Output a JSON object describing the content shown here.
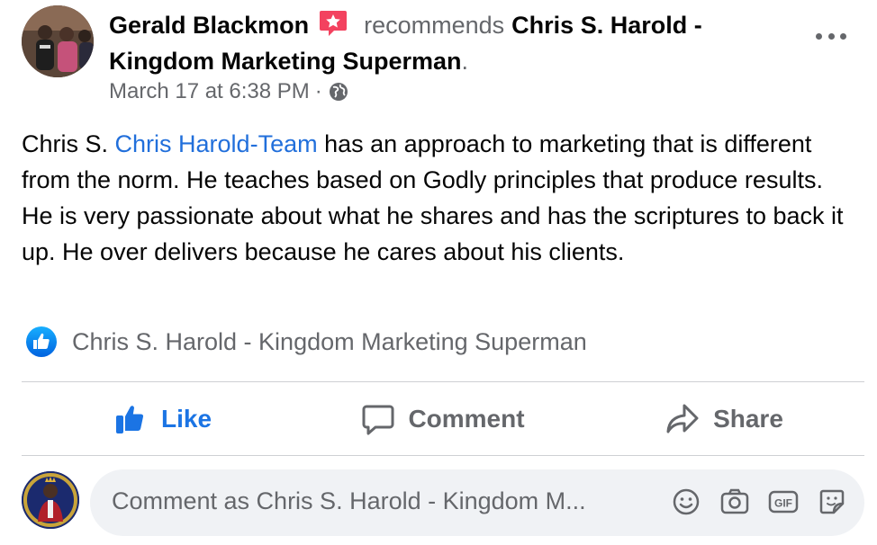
{
  "header": {
    "author": "Gerald Blackmon",
    "verb": "recommends",
    "page_name": "Chris S. Harold - Kingdom Marketing Superman",
    "period": ".",
    "timestamp": "March 17 at 6:38 PM",
    "separator": "·",
    "privacy_icon": "globe-icon",
    "more_icon": "more-options-icon",
    "badge_icon": "star-badge-icon"
  },
  "body": {
    "text_before_mention": "Chris S. ",
    "mention": "Chris Harold-Team",
    "text_after_mention": " has an approach to marketing that is different from the norm. He teaches based on Godly principles that produce results. He is very passionate about what he shares and has the scriptures to back it up. He over delivers because he cares about his clients."
  },
  "recommended_page": {
    "icon": "like-badge-icon",
    "name": "Chris S. Harold - Kingdom Marketing Superman"
  },
  "actions": {
    "like_label": "Like",
    "comment_label": "Comment",
    "share_label": "Share"
  },
  "comment_box": {
    "placeholder": "Comment as Chris S. Harold - Kingdom M...",
    "icons": [
      "emoji-icon",
      "camera-icon",
      "gif-icon",
      "sticker-icon"
    ]
  },
  "colors": {
    "accent": "#1b74e4",
    "mention": "#216fdb",
    "secondary_text": "#65676b",
    "badge": "#f3425f"
  }
}
